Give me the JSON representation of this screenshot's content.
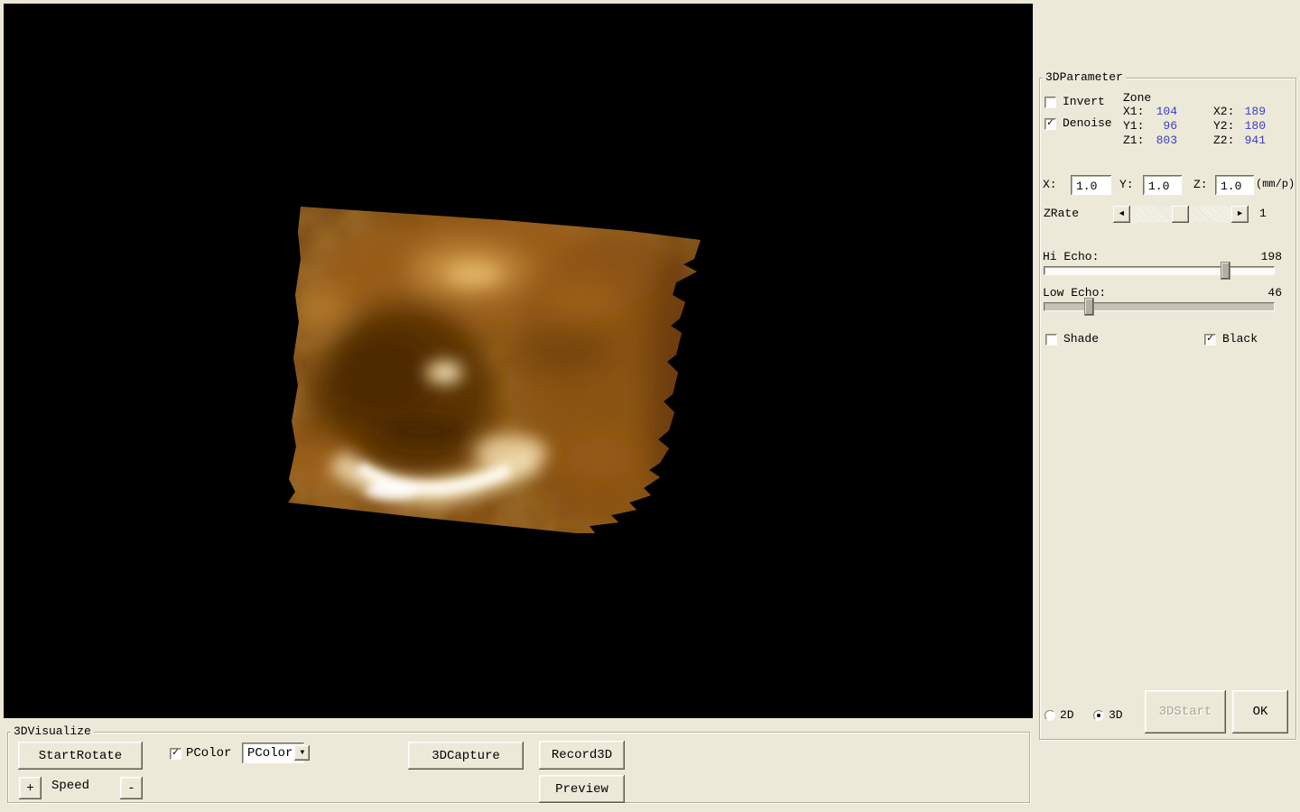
{
  "icons": {
    "check": "✓",
    "arrow_left": "◄",
    "arrow_right": "►",
    "dropdown": "▼"
  },
  "param_panel": {
    "title": "3DParameter",
    "invert": "Invert",
    "denoise": "Denoise",
    "zone": {
      "title": "Zone",
      "rows": [
        {
          "l1": "X1:",
          "v1": "104",
          "l2": "X2:",
          "v2": "189"
        },
        {
          "l1": "Y1:",
          "v1": "96",
          "l2": "Y2:",
          "v2": "180"
        },
        {
          "l1": "Z1:",
          "v1": "803",
          "l2": "Z2:",
          "v2": "941"
        }
      ]
    },
    "scale": {
      "x_label": "X:",
      "x_value": "1.0",
      "y_label": "Y:",
      "y_value": "1.0",
      "z_label": "Z:",
      "z_value": "1.0",
      "unit": "(mm/p)"
    },
    "zrate": {
      "label": "ZRate",
      "value": "1"
    },
    "hi_echo": {
      "label": "Hi Echo:",
      "value": "198"
    },
    "low_echo": {
      "label": "Low Echo:",
      "value": "46"
    },
    "shade": "Shade",
    "black": "Black",
    "mode_2d": "2D",
    "mode_3d": "3D",
    "start3d": "3DStart",
    "ok": "OK"
  },
  "visualize_panel": {
    "title": "3DVisualize",
    "start_rotate": "StartRotate",
    "pcolor_check": "PColor",
    "pcolor_select": "PColor",
    "plus": "+",
    "speed": "Speed",
    "minus": "-",
    "capture": "3DCapture",
    "record": "Record3D",
    "preview": "Preview"
  }
}
